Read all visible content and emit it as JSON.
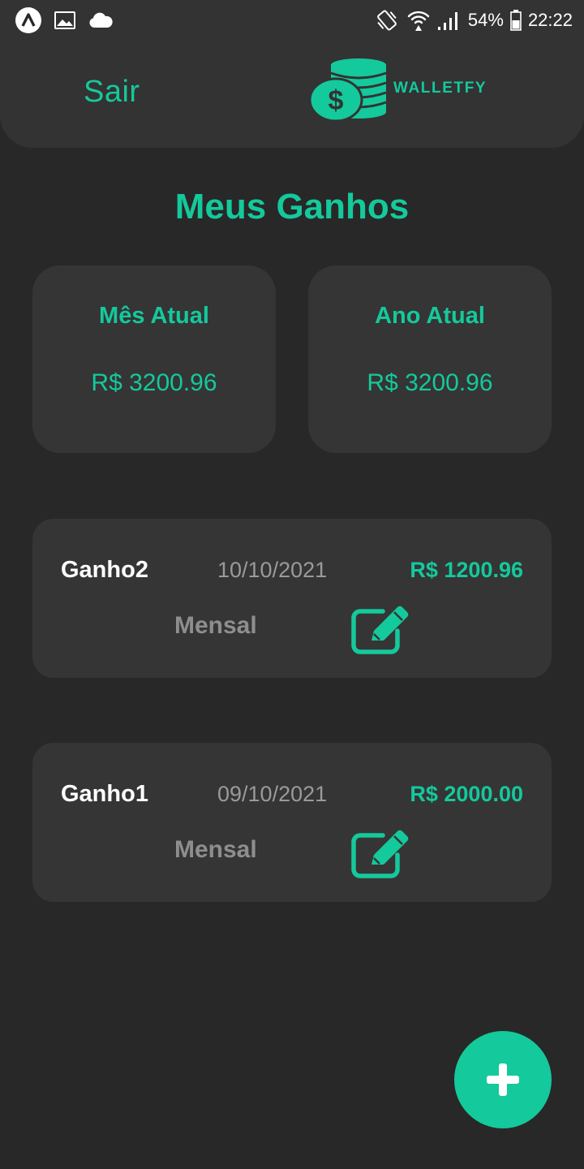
{
  "status_bar": {
    "battery": "54%",
    "time": "22:22",
    "icons_left": [
      "app-launcher-icon",
      "image-icon",
      "cloud-icon"
    ],
    "icons_right": [
      "vibrate-icon",
      "wifi-icon",
      "signal-icon",
      "battery-icon"
    ]
  },
  "header": {
    "logout_label": "Sair",
    "logo_text": "WALLETFY",
    "logo_icon": "coins-dollar-icon"
  },
  "page": {
    "title": "Meus Ganhos"
  },
  "summary": {
    "month": {
      "label": "Mês Atual",
      "value": "R$ 3200.96"
    },
    "year": {
      "label": "Ano Atual",
      "value": "R$ 3200.96"
    }
  },
  "entries": [
    {
      "name": "Ganho2",
      "date": "10/10/2021",
      "value": "R$ 1200.96",
      "frequency": "Mensal",
      "edit_icon": "edit-icon"
    },
    {
      "name": "Ganho1",
      "date": "09/10/2021",
      "value": "R$ 2000.00",
      "frequency": "Mensal",
      "edit_icon": "edit-icon"
    }
  ],
  "fab": {
    "icon": "plus-icon"
  },
  "colors": {
    "accent": "#14c99c",
    "background": "#282828",
    "card": "#353535",
    "header": "#333333",
    "muted_text": "#9a9a9a"
  }
}
